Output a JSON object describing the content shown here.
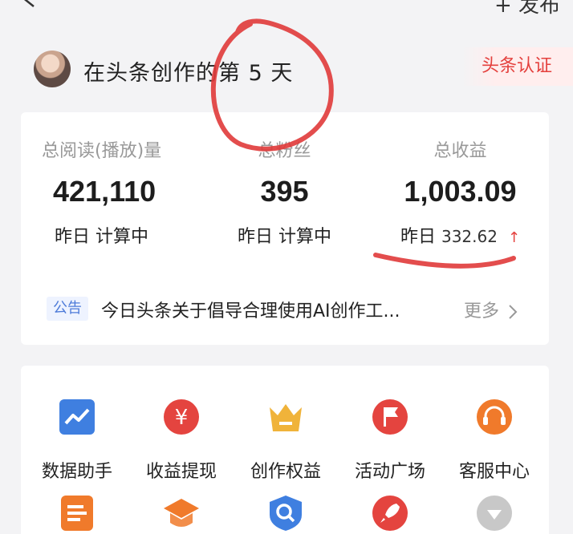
{
  "topbar": {
    "publish_label": "+ 发布"
  },
  "profile": {
    "title": "在头条创作的第 5 天",
    "cert_label": "头条认证"
  },
  "stats": [
    {
      "label": "总阅读(播放)量",
      "value": "421,110",
      "sub_prefix": "昨日",
      "sub_value": "计算中"
    },
    {
      "label": "总粉丝",
      "value": "395",
      "sub_prefix": "昨日",
      "sub_value": "计算中"
    },
    {
      "label": "总收益",
      "value": "1,003.09",
      "sub_prefix": "昨日",
      "sub_value": "332.62"
    }
  ],
  "notice": {
    "tag": "公告",
    "text": "今日头条关于倡导合理使用AI创作工...",
    "more": "更多"
  },
  "tools": [
    {
      "label": "数据助手",
      "icon": "chart-icon",
      "color": "#3f7fe0"
    },
    {
      "label": "收益提现",
      "icon": "yen-icon",
      "color": "#e4443f"
    },
    {
      "label": "创作权益",
      "icon": "crown-icon",
      "color": "#f0b33a"
    },
    {
      "label": "活动广场",
      "icon": "flag-icon",
      "color": "#e4443f"
    },
    {
      "label": "客服中心",
      "icon": "headset-icon",
      "color": "#f07a2b"
    },
    {
      "label": "",
      "icon": "document-icon",
      "color": "#f07a2b"
    },
    {
      "label": "",
      "icon": "graduation-cap-icon",
      "color": "#f07a2b"
    },
    {
      "label": "",
      "icon": "search-icon",
      "color": "#3f7fe0"
    },
    {
      "label": "",
      "icon": "rocket-icon",
      "color": "#e4443f"
    },
    {
      "label": "",
      "icon": "chevron-down-icon",
      "color": "#c8c8c8"
    }
  ]
}
